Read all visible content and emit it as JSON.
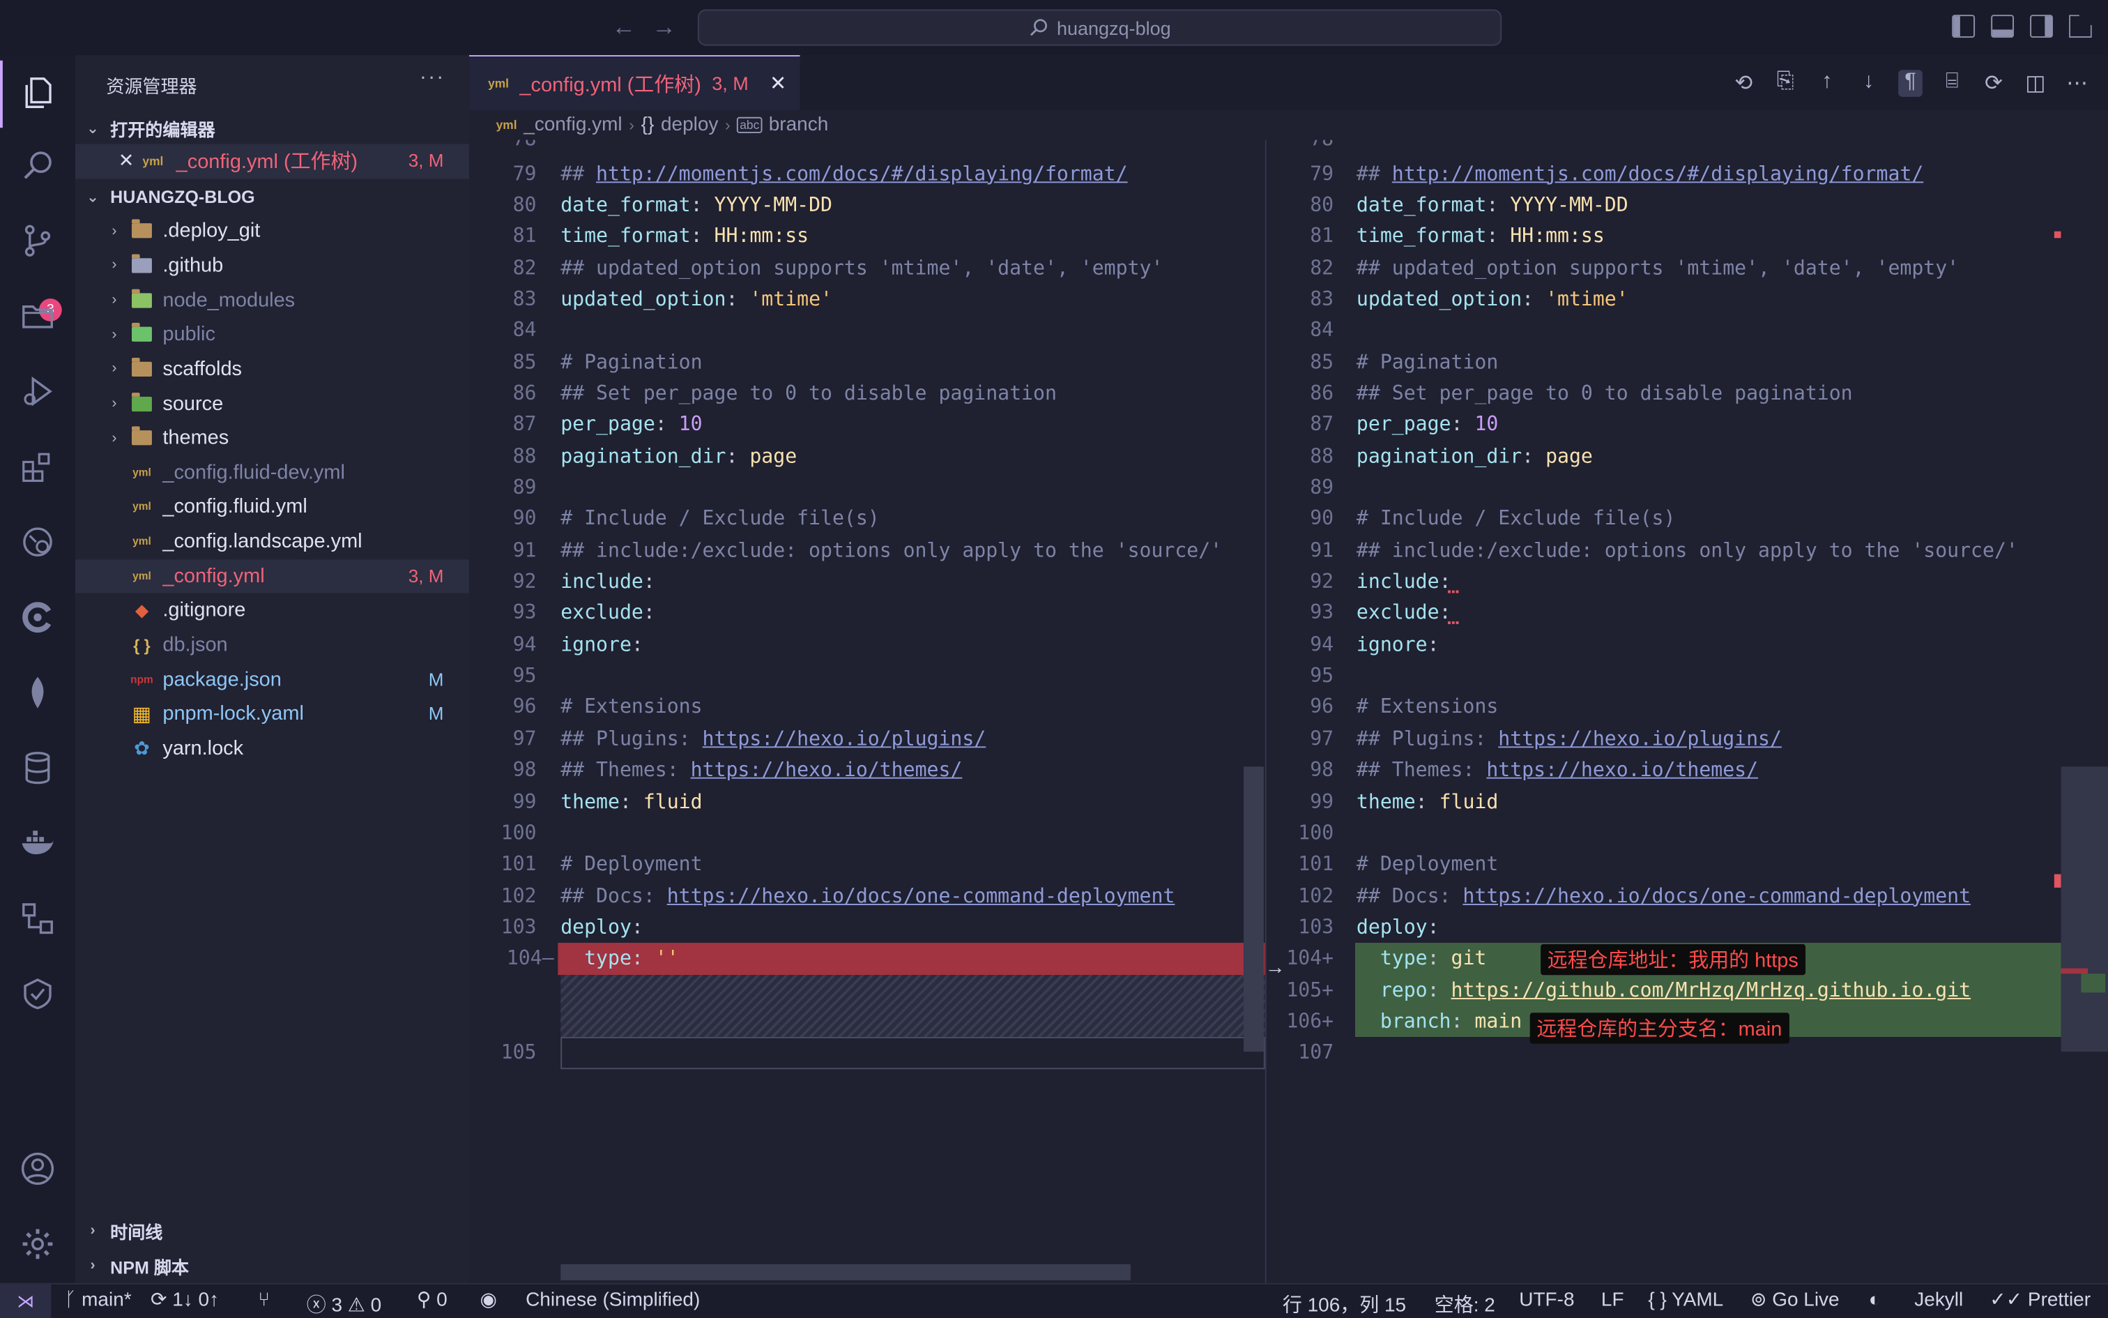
{
  "window": {
    "search_text": "huangzq-blog"
  },
  "activity": {
    "badge_count": "3"
  },
  "sidebar": {
    "title": "资源管理器",
    "more": "···",
    "open_editors_header": "打开的编辑器",
    "open_editor": {
      "name": "_config.yml (工作树)",
      "status": "3, M"
    },
    "project_header": "HUANGZQ-BLOG",
    "items": [
      {
        "name": ".deploy_git",
        "status": "",
        "type": "folder"
      },
      {
        "name": ".github",
        "status": "",
        "type": "folder"
      },
      {
        "name": "node_modules",
        "status": "",
        "type": "folder"
      },
      {
        "name": "public",
        "status": "",
        "type": "folder"
      },
      {
        "name": "scaffolds",
        "status": "",
        "type": "folder"
      },
      {
        "name": "source",
        "status": "",
        "type": "folder"
      },
      {
        "name": "themes",
        "status": "",
        "type": "folder"
      },
      {
        "name": "_config.fluid-dev.yml",
        "status": "",
        "type": "file"
      },
      {
        "name": "_config.fluid.yml",
        "status": "",
        "type": "file"
      },
      {
        "name": "_config.landscape.yml",
        "status": "",
        "type": "file"
      },
      {
        "name": "_config.yml",
        "status": "3, M",
        "type": "file"
      },
      {
        "name": ".gitignore",
        "status": "",
        "type": "file"
      },
      {
        "name": "db.json",
        "status": "",
        "type": "file"
      },
      {
        "name": "package.json",
        "status": "M",
        "type": "file"
      },
      {
        "name": "pnpm-lock.yaml",
        "status": "M",
        "type": "file"
      },
      {
        "name": "yarn.lock",
        "status": "",
        "type": "file"
      }
    ],
    "timeline_header": "时间线",
    "npm_header": "NPM 脚本"
  },
  "tab": {
    "label": "_config.yml (工作树)",
    "status": "3, M"
  },
  "breadcrumb": [
    "_config.yml",
    "deploy",
    "branch"
  ],
  "diff": {
    "left_lines": [
      {
        "n": "79",
        "parts": [
          [
            "com",
            "## "
          ],
          [
            "url",
            "http://momentjs.com/docs/#/displaying/format/"
          ]
        ]
      },
      {
        "n": "80",
        "parts": [
          [
            "key",
            "date_format"
          ],
          [
            "plain",
            ": "
          ],
          [
            "val",
            "YYYY-MM-DD"
          ]
        ]
      },
      {
        "n": "81",
        "parts": [
          [
            "key",
            "time_format"
          ],
          [
            "plain",
            ": "
          ],
          [
            "val",
            "HH:mm:ss"
          ]
        ]
      },
      {
        "n": "82",
        "parts": [
          [
            "com",
            "## updated_option supports 'mtime', 'date', 'empty'"
          ]
        ]
      },
      {
        "n": "83",
        "parts": [
          [
            "key",
            "updated_option"
          ],
          [
            "plain",
            ": "
          ],
          [
            "str2",
            "'mtime'"
          ]
        ]
      },
      {
        "n": "84",
        "parts": []
      },
      {
        "n": "85",
        "parts": [
          [
            "com",
            "# Pagination"
          ]
        ]
      },
      {
        "n": "86",
        "parts": [
          [
            "com",
            "## Set per_page to 0 to disable pagination"
          ]
        ]
      },
      {
        "n": "87",
        "parts": [
          [
            "key",
            "per_page"
          ],
          [
            "plain",
            ": "
          ],
          [
            "num",
            "10"
          ]
        ]
      },
      {
        "n": "88",
        "parts": [
          [
            "key",
            "pagination_dir"
          ],
          [
            "plain",
            ": "
          ],
          [
            "val",
            "page"
          ]
        ]
      },
      {
        "n": "89",
        "parts": []
      },
      {
        "n": "90",
        "parts": [
          [
            "com",
            "# Include / Exclude file(s)"
          ]
        ]
      },
      {
        "n": "91",
        "parts": [
          [
            "com",
            "## include:/exclude: options only apply to the 'source/' "
          ]
        ]
      },
      {
        "n": "92",
        "parts": [
          [
            "key",
            "include"
          ],
          [
            "plain",
            ":"
          ]
        ]
      },
      {
        "n": "93",
        "parts": [
          [
            "key",
            "exclude"
          ],
          [
            "plain",
            ":"
          ]
        ]
      },
      {
        "n": "94",
        "parts": [
          [
            "key",
            "ignore"
          ],
          [
            "plain",
            ":"
          ]
        ]
      },
      {
        "n": "95",
        "parts": []
      },
      {
        "n": "96",
        "parts": [
          [
            "com",
            "# Extensions"
          ]
        ]
      },
      {
        "n": "97",
        "parts": [
          [
            "com",
            "## Plugins: "
          ],
          [
            "url",
            "https://hexo.io/plugins/"
          ]
        ]
      },
      {
        "n": "98",
        "parts": [
          [
            "com",
            "## Themes: "
          ],
          [
            "url",
            "https://hexo.io/themes/"
          ]
        ]
      },
      {
        "n": "99",
        "parts": [
          [
            "key",
            "theme"
          ],
          [
            "plain",
            ": "
          ],
          [
            "val",
            "fluid"
          ]
        ]
      },
      {
        "n": "100",
        "parts": []
      },
      {
        "n": "101",
        "parts": [
          [
            "com",
            "# Deployment"
          ]
        ]
      },
      {
        "n": "102",
        "parts": [
          [
            "com",
            "## Docs: "
          ],
          [
            "url",
            "https://hexo.io/docs/one-command-deployment"
          ]
        ]
      },
      {
        "n": "103",
        "parts": [
          [
            "key",
            "deploy"
          ],
          [
            "plain",
            ":"
          ]
        ]
      },
      {
        "n": "104—",
        "parts": [
          [
            "plain",
            "  "
          ],
          [
            "key",
            "type"
          ],
          [
            "plain",
            ": "
          ],
          [
            "str2",
            "''"
          ]
        ]
      }
    ],
    "left_last": "105",
    "right_extra": [
      {
        "n": "104+",
        "parts": [
          [
            "plain",
            "  "
          ],
          [
            "key",
            "type"
          ],
          [
            "plain",
            ": "
          ],
          [
            "val",
            "git"
          ]
        ]
      },
      {
        "n": "105+",
        "parts": [
          [
            "plain",
            "  "
          ],
          [
            "key",
            "repo"
          ],
          [
            "plain",
            ": "
          ],
          [
            "val-url",
            "https://github.com/MrHzq/MrHzq.github.io.git"
          ]
        ]
      },
      {
        "n": "106+",
        "parts": [
          [
            "plain",
            "  "
          ],
          [
            "key",
            "branch"
          ],
          [
            "plain",
            ": "
          ],
          [
            "val",
            "main"
          ]
        ]
      },
      {
        "n": "107",
        "parts": []
      }
    ],
    "annotations": {
      "repo": "远程仓库地址：我用的 https",
      "branch": "远程仓库的主分支名：main"
    }
  },
  "status": {
    "branch": "main*",
    "sync": "1↓ 0↑",
    "errors": "3",
    "warnings": "0",
    "ports": "0",
    "language_pack": "Chinese (Simplified)",
    "position": "行 106，列 15",
    "spaces": "空格: 2",
    "encoding": "UTF-8",
    "eol": "LF",
    "lang": "YAML",
    "golive": "Go Live",
    "jekyll": "Jekyll",
    "prettier": "Prettier"
  }
}
